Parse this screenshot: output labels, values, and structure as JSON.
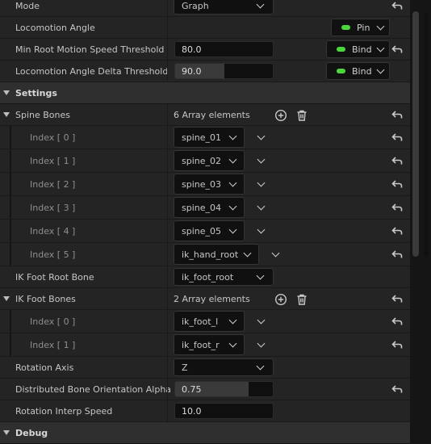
{
  "rows": {
    "mode": {
      "label": "Mode",
      "value": "Graph"
    },
    "locomotion_angle": {
      "label": "Locomotion Angle",
      "pin_label": "Pin"
    },
    "min_root_motion": {
      "label": "Min Root Motion Speed Threshold",
      "value": "80.0",
      "bind_label": "Bind"
    },
    "loco_angle_delta": {
      "label": "Locomotion Angle Delta Threshold",
      "value": "90.0",
      "bind_label": "Bind",
      "slider_fraction": 0.5
    },
    "settings": {
      "label": "Settings"
    },
    "spine_bones": {
      "label": "Spine Bones",
      "count": "6 Array elements",
      "items": [
        {
          "index": "Index [ 0 ]",
          "value": "spine_01"
        },
        {
          "index": "Index [ 1 ]",
          "value": "spine_02"
        },
        {
          "index": "Index [ 2 ]",
          "value": "spine_03"
        },
        {
          "index": "Index [ 3 ]",
          "value": "spine_04"
        },
        {
          "index": "Index [ 4 ]",
          "value": "spine_05"
        },
        {
          "index": "Index [ 5 ]",
          "value": "ik_hand_root"
        }
      ]
    },
    "ik_foot_root_bone": {
      "label": "IK Foot Root Bone",
      "value": "ik_foot_root"
    },
    "ik_foot_bones": {
      "label": "IK Foot Bones",
      "count": "2 Array elements",
      "items": [
        {
          "index": "Index [ 0 ]",
          "value": "ik_foot_l"
        },
        {
          "index": "Index [ 1 ]",
          "value": "ik_foot_r"
        }
      ]
    },
    "rotation_axis": {
      "label": "Rotation Axis",
      "value": "Z"
    },
    "distributed_alpha": {
      "label": "Distributed Bone Orientation Alpha",
      "value": "0.75",
      "slider_fraction": 0.75
    },
    "rotation_interp": {
      "label": "Rotation Interp Speed",
      "value": "10.0"
    },
    "debug": {
      "label": "Debug"
    }
  },
  "colors": {
    "accent_green": "#4bd63b",
    "panel": "#242424",
    "section": "#2f2f2f"
  },
  "icons": [
    "chevron-down-icon",
    "reset-arrow-icon",
    "add-element-icon",
    "trash-icon",
    "expand-triangle-icon"
  ]
}
